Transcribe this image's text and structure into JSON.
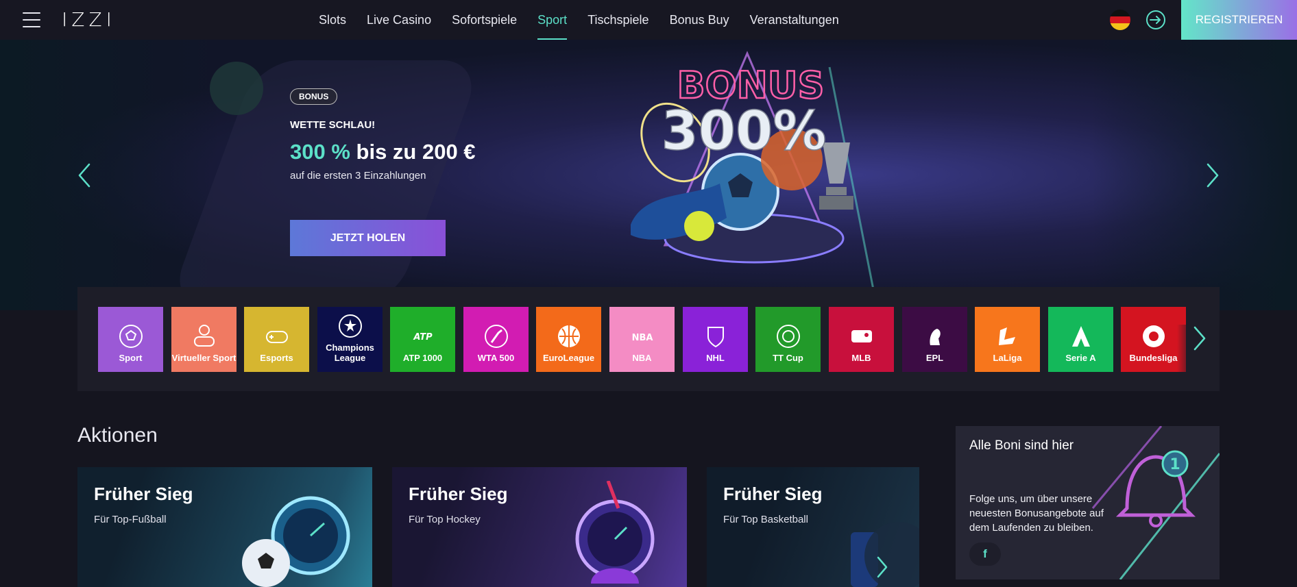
{
  "header": {
    "logo": "IZZI",
    "nav": [
      "Slots",
      "Live Casino",
      "Sofortspiele",
      "Sport",
      "Tischspiele",
      "Bonus Buy",
      "Veranstaltungen"
    ],
    "active_nav": "Sport",
    "register_label": "REGISTRIEREN",
    "language": "de-flag-icon"
  },
  "hero": {
    "badge": "BONUS",
    "kicker": "WETTE SCHLAU!",
    "title_accent": "300 %",
    "title_rest": " bis zu 200 €",
    "subtitle": "auf die ersten 3 Einzahlungen",
    "cta": "JETZT HOLEN",
    "art_text_top": "BONUS",
    "art_text_main": "300%"
  },
  "categories": [
    {
      "label": "Sport",
      "color": "#9b59d6"
    },
    {
      "label": "Virtueller Sport",
      "color": "#f07a62"
    },
    {
      "label": "Esports",
      "color": "#d6b630"
    },
    {
      "label": "Champions League",
      "color": "#0c0f4a"
    },
    {
      "label": "ATP 1000",
      "color": "#1fae2a"
    },
    {
      "label": "WTA 500",
      "color": "#d21cb2"
    },
    {
      "label": "EuroLeague",
      "color": "#f36a1a"
    },
    {
      "label": "NBA",
      "color": "#f48cc4"
    },
    {
      "label": "NHL",
      "color": "#8a22d8"
    },
    {
      "label": "TT Cup",
      "color": "#229a2a"
    },
    {
      "label": "MLB",
      "color": "#c8103c"
    },
    {
      "label": "EPL",
      "color": "#3c0c44"
    },
    {
      "label": "LaLiga",
      "color": "#f7761c"
    },
    {
      "label": "Serie A",
      "color": "#14b85a"
    },
    {
      "label": "Bundesliga",
      "color": "#d41420"
    }
  ],
  "section": {
    "title": "Aktionen"
  },
  "promos": [
    {
      "title": "Früher Sieg",
      "subtitle": "Für Top-Fußball"
    },
    {
      "title": "Früher Sieg",
      "subtitle": "Für Top Hockey"
    },
    {
      "title": "Früher Sieg",
      "subtitle": "Für Top Basketball"
    }
  ],
  "side_card": {
    "title": "Alle Boni sind hier",
    "text": "Folge uns, um über unsere neuesten Bonusangebote auf dem Laufenden zu bleiben.",
    "badge_count": "1",
    "social": "f"
  },
  "colors": {
    "accent": "#5ce0c8",
    "cta_start": "#5d78d8",
    "cta_end": "#8a50d8"
  }
}
